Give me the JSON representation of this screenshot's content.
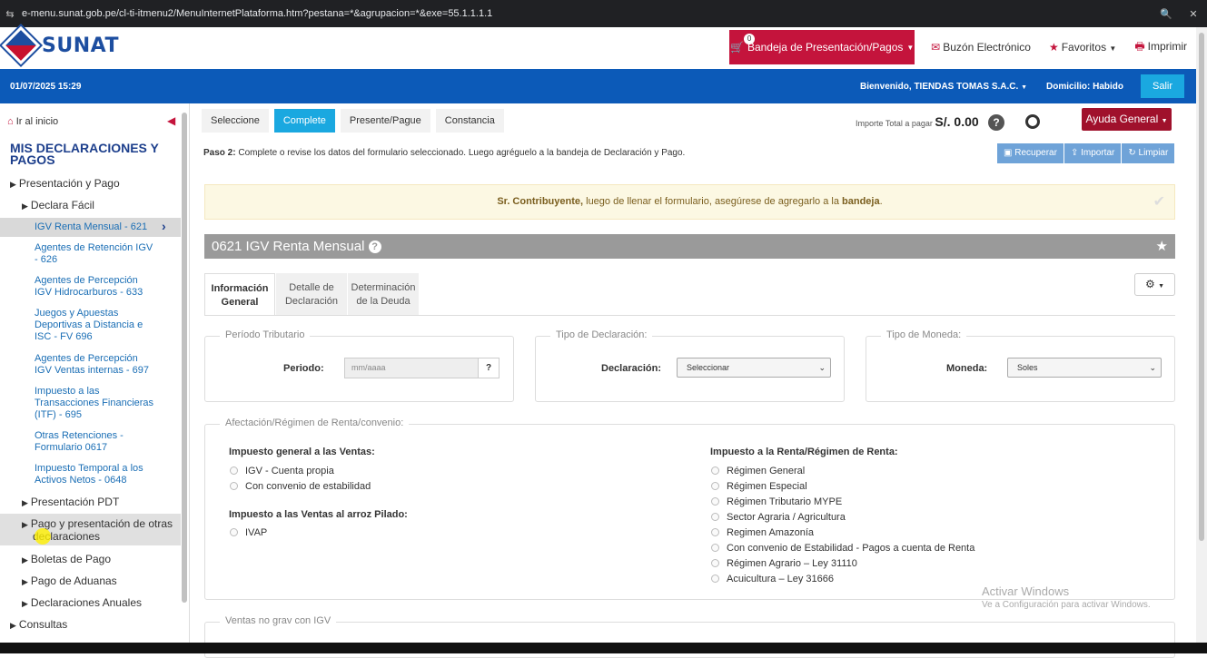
{
  "browser": {
    "url": "e-menu.sunat.gob.pe/cl-ti-itmenu2/MenuInternetPlataforma.htm?pestana=*&agrupacion=*&exe=55.1.1.1.1"
  },
  "header": {
    "logo_text": "SUNAT",
    "bandeja_count": "0",
    "bandeja_label": "Bandeja de Presentación/Pagos",
    "buzon_label": "Buzón Electrónico",
    "favoritos_label": "Favoritos",
    "imprimir_label": "Imprimir"
  },
  "bluebar": {
    "datetime": "01/07/2025 15:29",
    "welcome": "Bienvenido, TIENDAS TOMAS S.A.C.",
    "domicilio": "Domicilio: Habido",
    "salir": "Salir"
  },
  "sidebar": {
    "home": "Ir al inicio",
    "title": "MIS DECLARACIONES Y PAGOS",
    "presentacion_pago": "Presentación y Pago",
    "declara_facil": "Declara Fácil",
    "active_item": "IGV Renta Mensual - 621",
    "sub_items": [
      "Agentes de Retención IGV - 626",
      "Agentes de Percepción IGV Hidrocarburos - 633",
      "Juegos y Apuestas Deportivas a Distancia e ISC - FV 696",
      "Agentes de Percepción IGV Ventas internas - 697",
      "Impuesto a las Transacciones Financieras (ITF) - 695",
      "Otras Retenciones - Formulario 0617",
      "Impuesto Temporal a los Activos Netos - 0648"
    ],
    "presentacion_pdt": "Presentación PDT",
    "pago_otras": "Pago y presentación de otras declaraciones",
    "boletas": "Boletas de Pago",
    "aduanas": "Pago de Aduanas",
    "anuales": "Declaraciones Anuales",
    "consultas": "Consultas"
  },
  "steps": [
    "Seleccione",
    "Complete",
    "Presente/Pague",
    "Constancia"
  ],
  "importe": {
    "label": "Importe Total a pagar",
    "value": "S/. 0.00"
  },
  "ayuda": "Ayuda General",
  "paso": {
    "bold": "Paso 2:",
    "text": "Complete o revise los datos del formulario seleccionado. Luego agréguelo a la bandeja de Declaración y Pago."
  },
  "toolbar": {
    "recuperar": "Recuperar",
    "importar": "Importar",
    "limpiar": "Limpiar"
  },
  "alert": {
    "bold": "Sr. Contribuyente,",
    "text": "luego de llenar el formulario, asegúrese de agregarlo a la",
    "bold2": "bandeja",
    "end": "."
  },
  "form": {
    "title": "0621 IGV Renta Mensual",
    "tabs": [
      "Información General",
      "Detalle de Declaración",
      "Determinación de la Deuda"
    ],
    "periodo": {
      "legend": "Período Tributario",
      "label": "Periodo:",
      "placeholder": "mm/aaaa"
    },
    "tipo_decl": {
      "legend": "Tipo de Declaración:",
      "label": "Declaración:",
      "value": "Seleccionar"
    },
    "moneda": {
      "legend": "Tipo de Moneda:",
      "label": "Moneda:",
      "value": "Soles"
    },
    "afectacion": {
      "legend": "Afectación/Régimen de Renta/convenio:",
      "igv_head": "Impuesto general a las Ventas:",
      "igv_opts": [
        "IGV - Cuenta propia",
        "Con convenio de estabilidad"
      ],
      "ivap_head": "Impuesto a las Ventas al arroz Pilado:",
      "ivap_opts": [
        "IVAP"
      ],
      "renta_head": "Impuesto a la Renta/Régimen de Renta:",
      "renta_opts": [
        "Régimen General",
        "Régimen Especial",
        "Régimen Tributario MYPE",
        "Sector Agraria / Agricultura",
        "Regimen Amazonía",
        "Con convenio de Estabilidad - Pagos a cuenta de Renta",
        "Régimen Agrario – Ley 31110",
        "Acuicultura – Ley 31666"
      ]
    },
    "ventas_legend": "Ventas no grav con IGV"
  },
  "watermark": {
    "title": "Activar Windows",
    "sub": "Ve a Configuración para activar Windows."
  }
}
